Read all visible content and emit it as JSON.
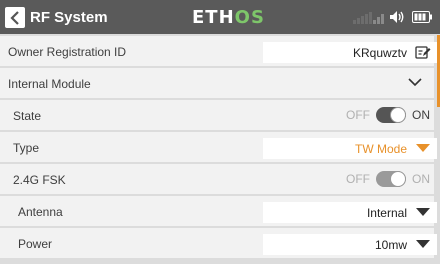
{
  "header": {
    "title": "RF System",
    "logo_main": "ETH",
    "logo_accent": "OS",
    "logo_accent_color": "#7ec66a",
    "icons": [
      "back-icon",
      "signal-icon",
      "volume-icon",
      "battery-icon"
    ]
  },
  "rows": {
    "owner_id": {
      "label": "Owner Registration ID",
      "value": "KRquwztv",
      "icon": "edit-icon"
    },
    "internal_module": {
      "label": "Internal Module",
      "icon": "chevron-down-icon"
    },
    "state": {
      "label": "State",
      "off_label": "OFF",
      "on_label": "ON",
      "value": "ON"
    },
    "type": {
      "label": "Type",
      "value": "TW Mode",
      "value_color": "#e8912a"
    },
    "fsk": {
      "label": "2.4G FSK",
      "off_label": "OFF",
      "on_label": "ON",
      "value": "ON",
      "enabled": false
    },
    "antenna": {
      "label": "Antenna",
      "value": "Internal"
    },
    "power": {
      "label": "Power",
      "value": "10mw"
    }
  },
  "accent_color": "#e8912a"
}
